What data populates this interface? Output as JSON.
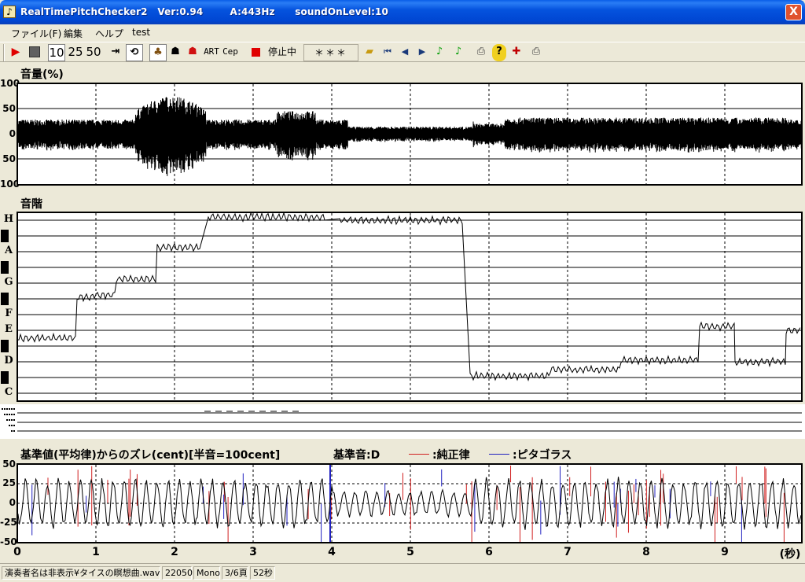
{
  "window": {
    "title": "RealTimePitchChecker2   Ver:0.94        A:443Hz      soundOnLevel:10",
    "close_label": "X"
  },
  "menu": [
    {
      "label": "ファイル(F)"
    },
    {
      "label": "編集"
    },
    {
      "label": "ヘルプ"
    },
    {
      "label": "test"
    }
  ],
  "toolbar": {
    "speed_10": "10",
    "speed_25": "25",
    "speed_50": "50",
    "art_label": "ART",
    "cep_label": "Cep",
    "status_label": "停止中",
    "note_display": "＊＊＊"
  },
  "volume_panel": {
    "title": "音量(%)",
    "ticks": [
      "100",
      "50",
      "0",
      "50",
      "100"
    ]
  },
  "scale_panel": {
    "title": "音階",
    "notes": [
      "H",
      "A",
      "G",
      "F",
      "E",
      "D",
      "C"
    ]
  },
  "deviation_panel": {
    "title": "基準値(平均律)からのズレ(cent)[半音=100cent]",
    "base_note": "基準音:D",
    "legend_just": ":純正律",
    "legend_pyth": ":ピタゴラス",
    "just_color": "#d02020",
    "pyth_color": "#2020c0",
    "ticks": [
      "50",
      "25",
      "0",
      "-25",
      "-50"
    ]
  },
  "time_axis": {
    "ticks": [
      "0",
      "1",
      "2",
      "3",
      "4",
      "5",
      "6",
      "7",
      "8",
      "9"
    ],
    "unit": "(秒)"
  },
  "statusbar": {
    "file": "演奏者名は非表示¥タイスの瞑想曲.wav",
    "rate": "22050",
    "channel": "Mono",
    "page": "3/6頁",
    "length": "52秒"
  }
}
